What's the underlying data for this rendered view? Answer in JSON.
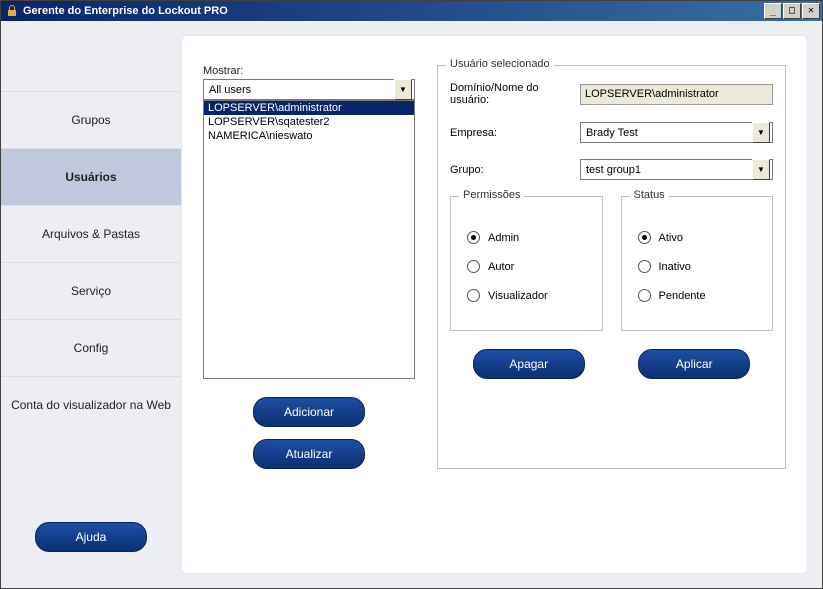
{
  "title": "Gerente do Enterprise do Lockout PRO",
  "sidebar": {
    "items": [
      {
        "label": "Grupos"
      },
      {
        "label": "Usuários"
      },
      {
        "label": "Arquivos & Pastas"
      },
      {
        "label": "Serviço"
      },
      {
        "label": "Config"
      },
      {
        "label": "Conta do visualizador na Web"
      }
    ],
    "active_index": 1,
    "help_label": "Ajuda"
  },
  "main": {
    "show_label": "Mostrar:",
    "show_value": "All users",
    "list": [
      "LOPSERVER\\administrator",
      "LOPSERVER\\sqatester2",
      "NAMERICA\\nieswato"
    ],
    "selected_list_index": 0,
    "left_buttons": {
      "add": "Adicionar",
      "refresh": "Atualizar"
    },
    "selected_user_legend": "Usuário selecionado",
    "fields": {
      "domain_label": "Domínio/Nome do usuário:",
      "domain_value": "LOPSERVER\\administrator",
      "company_label": "Empresa:",
      "company_value": "Brady Test",
      "group_label": "Grupo:",
      "group_value": "test group1"
    },
    "permissions": {
      "legend": "Permissões",
      "options": [
        "Admin",
        "Autor",
        "Visualizador"
      ],
      "selected": 0
    },
    "status": {
      "legend": "Status",
      "options": [
        "Ativo",
        "Inativo",
        "Pendente"
      ],
      "selected": 0
    },
    "right_buttons": {
      "delete": "Apagar",
      "apply": "Aplicar"
    }
  }
}
